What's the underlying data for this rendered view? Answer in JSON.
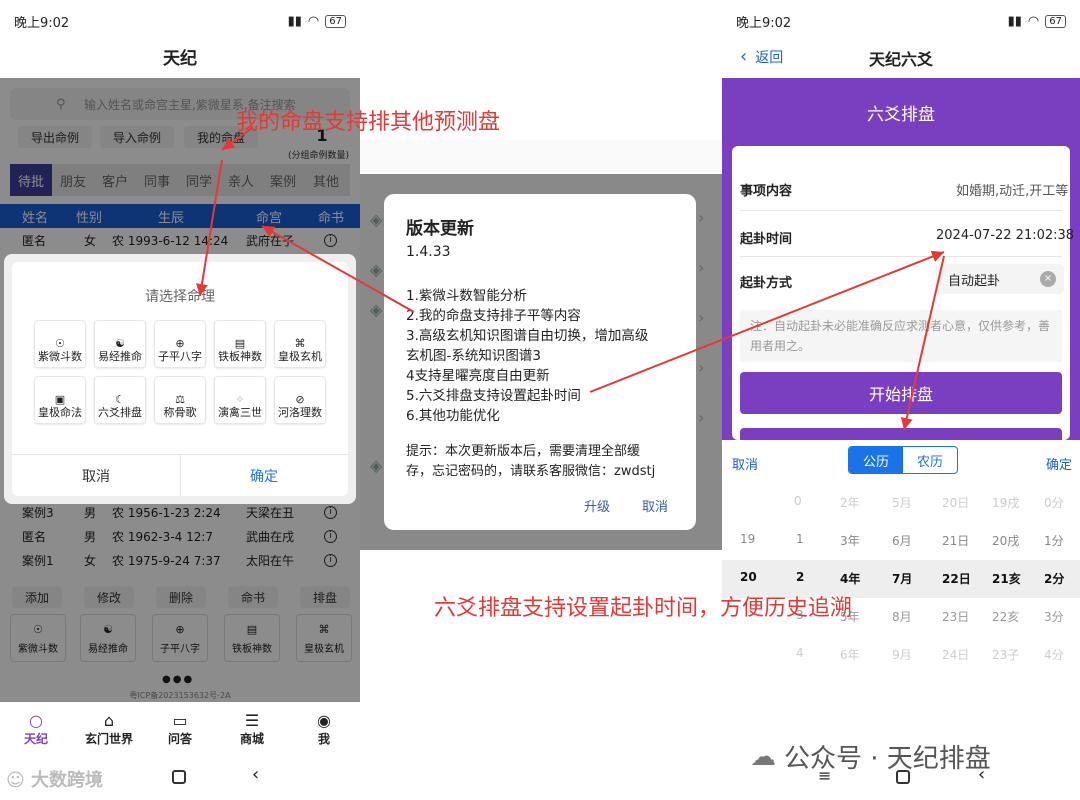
{
  "left": {
    "status_time": "晚上9:02",
    "battery": "67",
    "title": "天纪",
    "search_placeholder": "输入姓名或命宫主星,紫微星系,备注搜索",
    "action_buttons": [
      "导出命例",
      "导入命例",
      "我的命盘"
    ],
    "count": "1",
    "count_label": "(分组命例数量)",
    "tabs": [
      "待批",
      "朋友",
      "客户",
      "同事",
      "同学",
      "亲人",
      "案例",
      "其他"
    ],
    "table_headers": [
      "姓名",
      "性别",
      "生辰",
      "命宫",
      "命书"
    ],
    "row_top": {
      "name": "匿名",
      "gender": "女",
      "birth": "农 1993-6-12 14:24",
      "palace": "武府在子"
    },
    "rows_bottom": [
      {
        "name": "案例3",
        "gender": "男",
        "birth": "农 1956-1-23 2:24",
        "palace": "天梁在丑"
      },
      {
        "name": "匿名",
        "gender": "男",
        "birth": "农 1962-3-4 12:7",
        "palace": "武曲在戌"
      },
      {
        "name": "案例1",
        "gender": "女",
        "birth": "农 1975-9-24 7:37",
        "palace": "太阳在午"
      }
    ],
    "dialog": {
      "title": "请选择命理",
      "items": [
        "紫微斗数",
        "易经推命",
        "子平八字",
        "铁板神数",
        "皇极玄机",
        "皇极命法",
        "六爻排盘",
        "称骨歌",
        "演禽三世",
        "河洛理数"
      ],
      "cancel": "取消",
      "confirm": "确定"
    },
    "bottom_actions": [
      "添加",
      "修改",
      "删除",
      "命书",
      "排盘"
    ],
    "bottom_grid": [
      "紫微斗数",
      "易经推命",
      "子平八字",
      "铁板神数",
      "皇极玄机"
    ],
    "icp": "粤ICP备2023153632号-2A",
    "nav": [
      "天纪",
      "玄门世界",
      "问答",
      "商城",
      "我"
    ]
  },
  "middle": {
    "title": "版本更新",
    "version": "1.4.33",
    "lines": [
      "1.紫微斗数智能分析",
      "2.我的命盘支持排子平等内容",
      "3.高级玄机知识图谱自由切换，增加高级",
      "玄机图-系统知识图谱3",
      "4支持星曜亮度自由更新",
      "5.六爻排盘支持设置起卦时间",
      "6.其他功能优化"
    ],
    "tip_1": "提示：本次更新版本后，需要清理全部缓",
    "tip_2": "存，忘记密码的，请联系客服微信：zwdstj",
    "upgrade": "升级",
    "cancel": "取消"
  },
  "right": {
    "status_time": "晚上9:02",
    "battery": "67",
    "back": "返回",
    "title": "天纪六爻",
    "banner": "六爻排盘",
    "field_1_label": "事项内容",
    "field_1_value": "如婚期,动迁,开工等",
    "field_2_label": "起卦时间",
    "field_2_value": "2024-07-22 21:02:38",
    "field_3_label": "起卦方式",
    "field_3_value": "自动起卦",
    "note": "注：自动起卦未必能准确反应求测者心意，仅供参考，善用者用之。",
    "start": "开始排盘",
    "picker_cancel": "取消",
    "picker_confirm": "确定",
    "seg": [
      "公历",
      "农历"
    ],
    "picker_rows": [
      [
        "0",
        "2年",
        "5月",
        "20日",
        "19戌",
        "0分"
      ],
      [
        "19",
        "1",
        "3年",
        "6月",
        "21日",
        "20戌",
        "1分"
      ],
      [
        "20",
        "2",
        "4年",
        "7月",
        "22日",
        "21亥",
        "2分"
      ],
      [
        "3",
        "5年",
        "8月",
        "23日",
        "22亥",
        "3分"
      ],
      [
        "4",
        "6年",
        "9月",
        "24日",
        "23子",
        "4分"
      ]
    ]
  },
  "annotations": {
    "top": "我的命盘支持排其他预测盘",
    "bottom": "六爻排盘支持设置起卦时间，方便历史追溯"
  },
  "watermark_left": "大数跨境",
  "watermark_right": "公众号 · 天纪排盘",
  "colors": {
    "accent": "#7a3fc0",
    "blue": "#1a73e8",
    "red": "#e53935"
  }
}
